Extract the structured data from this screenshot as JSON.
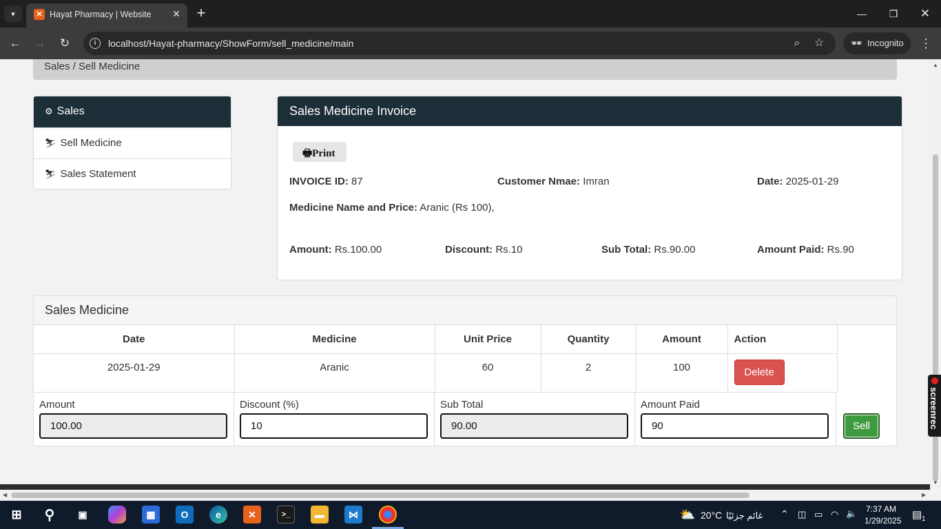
{
  "browser": {
    "tab_title": "Hayat Pharmacy | Website",
    "url": "localhost/Hayat-pharmacy/ShowForm/sell_medicine/main",
    "incognito_label": "Incognito"
  },
  "breadcrumb": "Sales / Sell Medicine",
  "sidebar": {
    "title": "Sales",
    "items": [
      {
        "label": "Sell Medicine"
      },
      {
        "label": "Sales Statement"
      }
    ]
  },
  "invoice": {
    "title": "Sales Medicine Invoice",
    "print_label": "Print",
    "invoice_id_label": "INVOICE ID:",
    "invoice_id": "87",
    "customer_label": "Customer Nmae:",
    "customer": "Imran",
    "date_label": "Date:",
    "date": "2025-01-29",
    "medicine_label": "Medicine Name and Price:",
    "medicine": "Aranic (Rs 100),",
    "amount_label": "Amount:",
    "amount": "Rs.100.00",
    "discount_label": "Discount:",
    "discount": "Rs.10",
    "subtotal_label": "Sub Total:",
    "subtotal": "Rs.90.00",
    "paid_label": "Amount Paid:",
    "paid": "Rs.90"
  },
  "sales": {
    "title": "Sales Medicine",
    "columns": [
      "Date",
      "Medicine",
      "Unit Price",
      "Quantity",
      "Amount",
      "Action"
    ],
    "rows": [
      {
        "date": "2025-01-29",
        "medicine": "Aranic",
        "unit_price": "60",
        "quantity": "2",
        "amount": "100",
        "action": "Delete"
      }
    ],
    "footer": {
      "amount_label": "Amount",
      "amount_value": "100.00",
      "discount_label": "Discount (%)",
      "discount_value": "10",
      "subtotal_label": "Sub Total",
      "subtotal_value": "90.00",
      "paid_label": "Amount Paid",
      "paid_value": "90",
      "sell_label": "Sell"
    }
  },
  "overlay": {
    "screenrec_label": "screenrec"
  },
  "taskbar": {
    "weather": "20°C",
    "weather_text": "غائم جزئيًا",
    "time": "7:37 AM",
    "date": "1/29/2025",
    "notifications": "1"
  },
  "colors": {
    "panel_header": "#1c2e38",
    "delete_button": "#d9534f",
    "sell_button": "#3e9a3e"
  }
}
